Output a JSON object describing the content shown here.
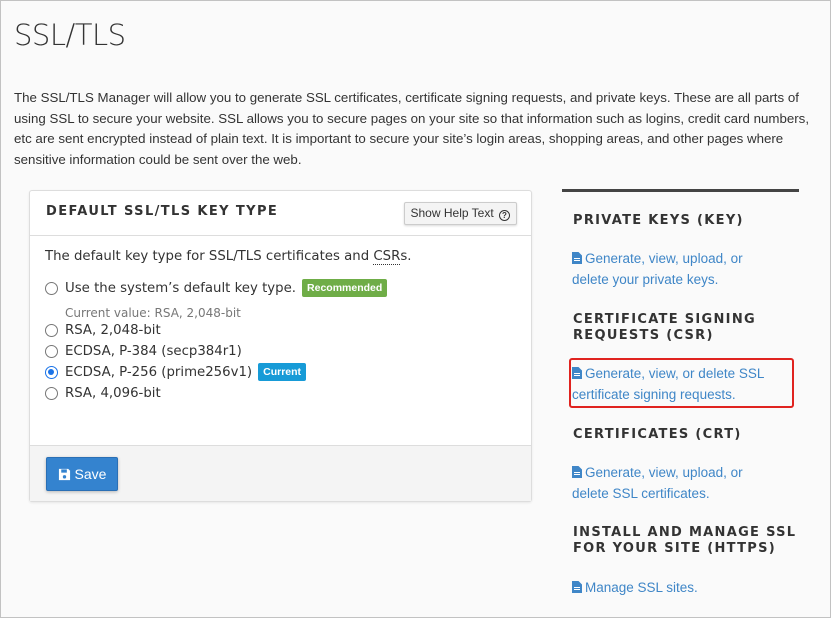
{
  "page": {
    "title": "SSL/TLS",
    "intro": "The SSL/TLS Manager will allow you to generate SSL certificates, certificate signing requests, and private keys. These are all parts of using SSL to secure your website. SSL allows you to secure pages on your site so that information such as logins, credit card numbers, etc are sent encrypted instead of plain text. It is important to secure your site’s login areas, shopping areas, and other pages where sensitive information could be sent over the web."
  },
  "panel": {
    "title": "DEFAULT SSL/TLS KEY TYPE",
    "help_button": "Show Help Text",
    "help_icon": "question-circle-icon",
    "description_prefix": "The default key type for SSL/TLS certificates and ",
    "description_abbr": "CSR",
    "description_suffix": "s.",
    "options": [
      {
        "label": "Use the system’s default key type.",
        "badge": "Recommended",
        "checked": false
      },
      {
        "label": "RSA, 2,048-bit",
        "checked": false
      },
      {
        "label": "ECDSA, P-384 (secp384r1)",
        "checked": false
      },
      {
        "label": "ECDSA, P-256 (prime256v1)",
        "badge": "Current",
        "checked": true
      },
      {
        "label": "RSA, 4,096-bit",
        "checked": false
      }
    ],
    "current_value": "Current value: RSA, 2,048-bit",
    "save_label": "Save",
    "colors": {
      "recommended": "#6fad47",
      "current": "#179bd7",
      "save": "#3483cf"
    }
  },
  "sidebar": {
    "sections": [
      {
        "heading": "PRIVATE KEYS (KEY)",
        "link_line1": "Generate, view, upload, or",
        "link_line2": "delete your private keys."
      },
      {
        "heading_line1": "CERTIFICATE SIGNING",
        "heading_line2": "REQUESTS (CSR)",
        "link_line1": "Generate, view, or delete SSL",
        "link_line2": "certificate signing requests.",
        "highlighted": true
      },
      {
        "heading": "CERTIFICATES (CRT)",
        "link_line1": "Generate, view, upload, or",
        "link_line2": "delete SSL certificates."
      },
      {
        "heading_line1": "INSTALL AND MANAGE SSL",
        "heading_line2": "FOR YOUR SITE (HTTPS)",
        "link_line1": "Manage SSL sites."
      }
    ],
    "link_icon": "file-icon",
    "colors": {
      "link": "#3f86c7",
      "highlight": "#e0231f"
    }
  }
}
